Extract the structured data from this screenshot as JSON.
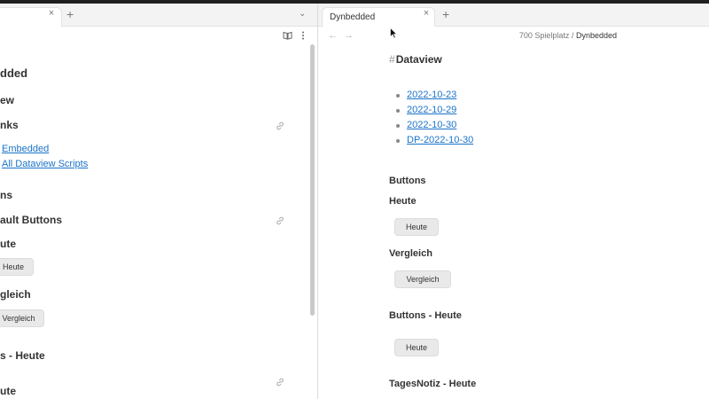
{
  "left": {
    "tab_new": "+",
    "tab_close": "×",
    "chevron": "⌄",
    "toolbar": {
      "reader_icon": "book-open-icon",
      "more_icon": "more-vertical-icon"
    },
    "title": "dded",
    "h_view": "ew",
    "h_links": "nks",
    "links": [
      "Embedded",
      "All Dataview Scripts"
    ],
    "h_ns": "ns",
    "h_default_buttons": "ault Buttons",
    "h_heute": "ute",
    "btn_heute": "Heute",
    "h_vergleich": "gleich",
    "btn_vergleich": "Vergleich",
    "h_buttons_heute": "s - Heute",
    "h_heute2": "ute"
  },
  "right": {
    "tab_label": "Dynbedded",
    "tab_close": "×",
    "tab_new": "+",
    "nav_back": "←",
    "nav_forward": "→",
    "breadcrumb": {
      "folder": "700 Spielplatz",
      "sep": "/",
      "current": "Dynbedded"
    },
    "heading_hash": "#",
    "heading": "Dataview",
    "dates": [
      "2022-10-23",
      "2022-10-29",
      "2022-10-30",
      "DP-2022-10-30"
    ],
    "buttons_heading": "Buttons",
    "heute_heading": "Heute",
    "heute_btn": "Heute",
    "vergleich_heading": "Vergleich",
    "vergleich_btn": "Vergleich",
    "buttons_heute_heading": "Buttons - Heute",
    "buttons_heute_btn": "Heute",
    "tagesnotiz_heading": "TagesNotiz - Heute"
  },
  "colors": {
    "link": "#1a73c9",
    "button_bg": "#e9e9e9",
    "tabstrip_bg": "#f3f3f3"
  }
}
